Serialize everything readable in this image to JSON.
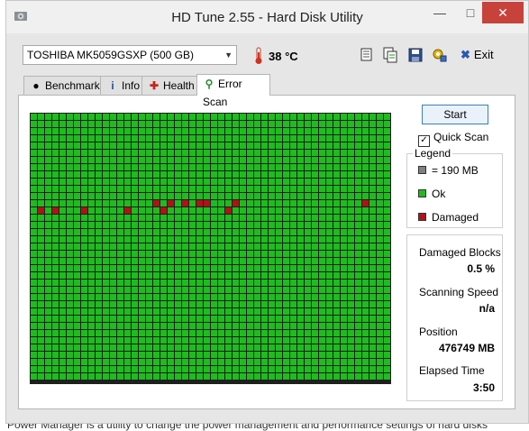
{
  "window": {
    "title": "HD Tune 2.55 - Hard Disk Utility"
  },
  "toolbar": {
    "drive": "TOSHIBA MK5059GSXP (500 GB)",
    "temperature": "38 °C",
    "exit_label": "Exit",
    "tools": [
      "copy-icon",
      "copy-all-icon",
      "save-icon",
      "options-icon"
    ]
  },
  "tabs": [
    {
      "label": "Benchmark",
      "icon": "benchmark-icon"
    },
    {
      "label": "Info",
      "icon": "info-icon"
    },
    {
      "label": "Health",
      "icon": "health-icon"
    },
    {
      "label": "Error Scan",
      "icon": "search-icon",
      "active": true
    }
  ],
  "scan": {
    "start_label": "Start",
    "quick_scan_label": "Quick Scan",
    "quick_scan_checked": true
  },
  "legend": {
    "title": "Legend",
    "items": [
      {
        "label": "= 190 MB",
        "color": "#808080"
      },
      {
        "label": "Ok",
        "color": "#1ebc1e"
      },
      {
        "label": "Damaged",
        "color": "#b0121a"
      }
    ]
  },
  "stats": {
    "damaged_blocks_label": "Damaged Blocks",
    "damaged_blocks_value": "0.5 %",
    "scanning_speed_label": "Scanning Speed",
    "scanning_speed_value": "n/a",
    "position_label": "Position",
    "position_value": "476749 MB",
    "elapsed_time_label": "Elapsed Time",
    "elapsed_time_value": "3:50"
  },
  "grid": {
    "columns": 50,
    "rows": 37,
    "ok_color": "#1ebc1e",
    "damaged_color": "#b0121a",
    "damaged_cells": [
      [
        13,
        1
      ],
      [
        13,
        3
      ],
      [
        13,
        7
      ],
      [
        13,
        13
      ],
      [
        12,
        17
      ],
      [
        13,
        18
      ],
      [
        12,
        19
      ],
      [
        12,
        21
      ],
      [
        12,
        23
      ],
      [
        12,
        24
      ],
      [
        13,
        27
      ],
      [
        12,
        28
      ],
      [
        12,
        46
      ]
    ]
  },
  "background": {
    "bottom_text": "Power Manager is a utility to change the power management and performance settings of hard disks"
  }
}
